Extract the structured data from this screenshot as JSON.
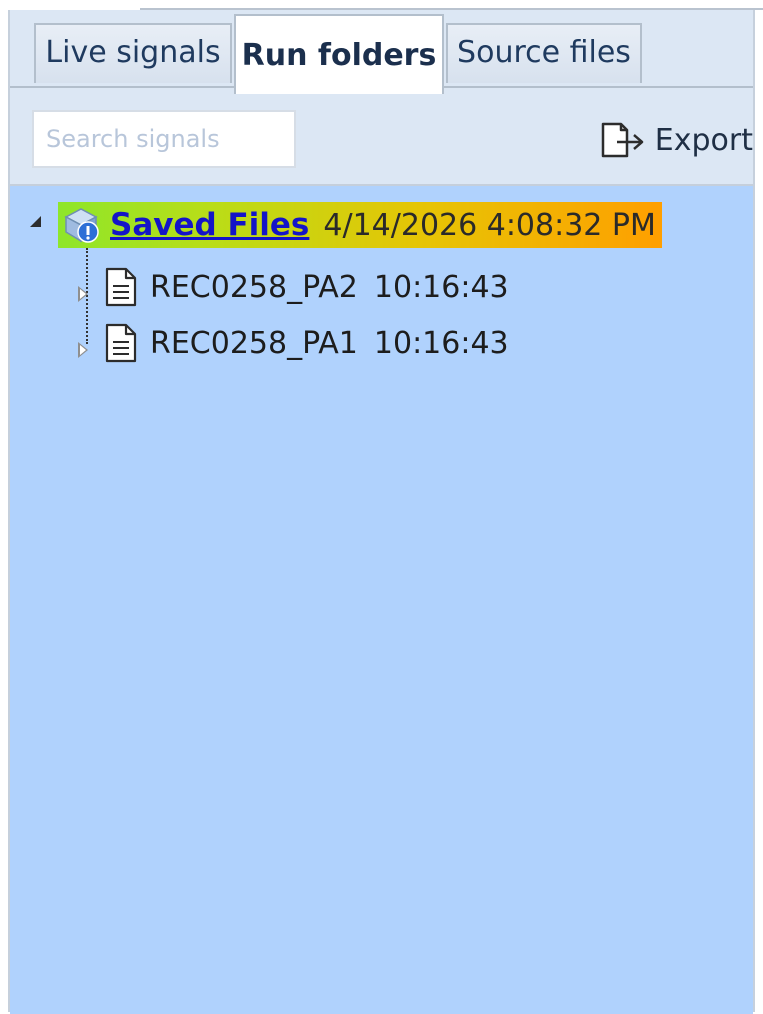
{
  "tabs": [
    {
      "label": "Live signals",
      "active": false
    },
    {
      "label": "Run folders",
      "active": true
    },
    {
      "label": "Source files",
      "active": false
    }
  ],
  "toolbar": {
    "search_placeholder": "Search signals",
    "export_label": "Export",
    "export_icon": "export-icon"
  },
  "tree": {
    "root": {
      "name": "Saved Files",
      "timestamp": "4/14/2026 4:08:32 PM",
      "icon": "folder-shield-icon",
      "expanded": true
    },
    "children": [
      {
        "name": "REC0258_PA2",
        "time": "10:16:43",
        "icon": "document-icon",
        "expanded": false
      },
      {
        "name": "REC0258_PA1",
        "time": "10:16:43",
        "icon": "document-icon",
        "expanded": false
      }
    ]
  },
  "colors": {
    "panel_background": "#dce7f4",
    "tree_background": "#b0d2fd",
    "root_highlight_start": "#8ee62a",
    "root_highlight_end": "#ff9f00",
    "link_color": "#1414c8"
  }
}
